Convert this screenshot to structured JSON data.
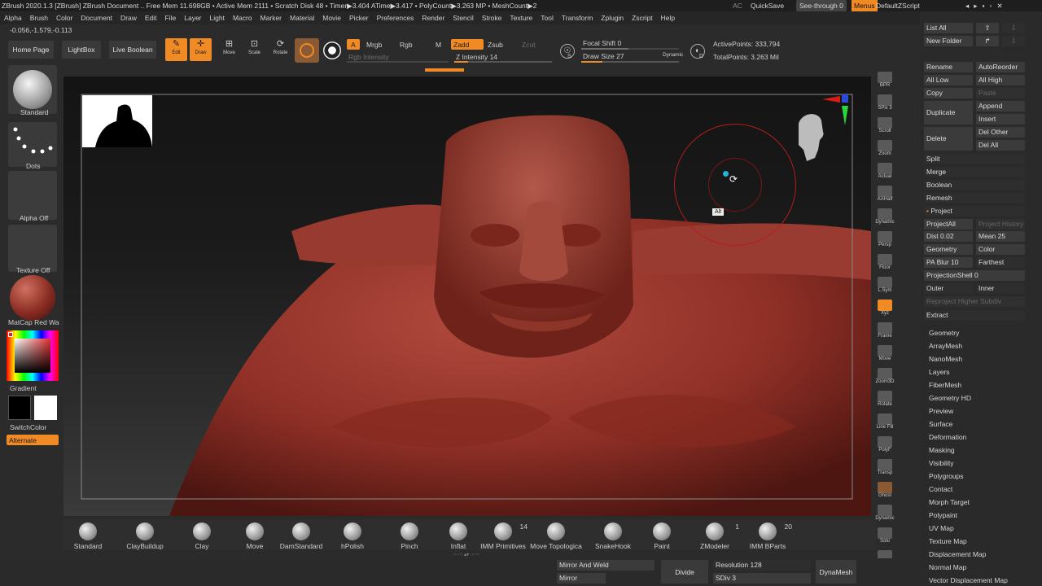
{
  "titlebar": {
    "text": "ZBrush 2020.1.3 [ZBrush]   ZBrush Document     .. Free Mem 11.698GB • Active Mem 2111 • Scratch Disk 48 •  Timer▶3.404 ATime▶3.417 • PolyCount▶3.263 MP  • MeshCount▶2",
    "ac": "AC",
    "quicksave": "QuickSave",
    "seethrough": "See-through  0",
    "menus": "Menus",
    "defaultzscript": "DefaultZScript"
  },
  "menubar": [
    "Alpha",
    "Brush",
    "Color",
    "Document",
    "Draw",
    "Edit",
    "File",
    "Layer",
    "Light",
    "Macro",
    "Marker",
    "Material",
    "Movie",
    "Picker",
    "Preferences",
    "Render",
    "Stencil",
    "Stroke",
    "Texture",
    "Tool",
    "Transform",
    "Zplugin",
    "Zscript",
    "Help"
  ],
  "coords": "-0.056,-1.579,-0.113",
  "toolbar": {
    "home": "Home Page",
    "lightbox": "LightBox",
    "liveboolean": "Live Boolean",
    "edit": "Edit",
    "draw": "Draw",
    "move": "Move",
    "scale": "Scale",
    "rotate": "Rotate",
    "a": "A",
    "mrgb": "Mrgb",
    "rgb": "Rgb",
    "m": "M",
    "zadd": "Zadd",
    "zsub": "Zsub",
    "zcut": "Zcut",
    "rgb_intensity": "Rgb Intensity",
    "z_intensity": "Z Intensity 14",
    "z_intensity_level": 0.14,
    "focal": "Focal Shift 0",
    "drawsize": "Draw Size 27",
    "dynamic": "Dynamic",
    "activepoints": "ActivePoints: 333,794",
    "totalpoints": "TotalPoints: 3.263 Mil",
    "s": "S",
    "d": "D"
  },
  "leftpanel": {
    "standard": "Standard",
    "dots": "Dots",
    "alphaoff": "Alpha Off",
    "textureoff": "Texture Off",
    "matcap": "MatCap Red Wa",
    "gradient": "Gradient",
    "switchcolor": "SwitchColor",
    "alternate": "Alternate"
  },
  "viewport": {
    "alt_label": "Alt"
  },
  "righttools": [
    "BPR",
    "SPix 3",
    "Scroll",
    "Zoom",
    "Actual",
    "AAHalf",
    "Dynamic",
    "Persp",
    "Floor",
    "L.Sym",
    "Xyz",
    "Frame",
    "Move",
    "Zoom3D",
    "Rotate",
    "Line Fill",
    "PolyF",
    "Transp",
    "Ghost",
    "Dynamic",
    "Solo",
    "Xpose"
  ],
  "rpanel": {
    "listall": "List All",
    "newfolder": "New Folder",
    "rename": "Rename",
    "autoreorder": "AutoReorder",
    "alllow": "All Low",
    "allhigh": "All High",
    "copy": "Copy",
    "paste": "Paste",
    "duplicate": "Duplicate",
    "append": "Append",
    "insert": "Insert",
    "delete": "Delete",
    "delother": "Del Other",
    "delall": "Del All",
    "split": "Split",
    "merge": "Merge",
    "boolean": "Boolean",
    "remesh": "Remesh",
    "project": "Project",
    "projectall": "ProjectAll",
    "projecthistory": "Project History",
    "dist": "Dist 0.02",
    "mean": "Mean 25",
    "geometry_btn": "Geometry",
    "color_btn": "Color",
    "pablur": "PA Blur 10",
    "farthest": "Farthest",
    "projectionshell": "ProjectionShell 0",
    "outer": "Outer",
    "inner": "Inner",
    "reproject": "Reproject Higher Subdiv",
    "extract": "Extract",
    "subpalettes": [
      "Geometry",
      "ArrayMesh",
      "NanoMesh",
      "Layers",
      "FiberMesh",
      "Geometry HD",
      "Preview",
      "Surface",
      "Deformation",
      "Masking",
      "Visibility",
      "Polygroups",
      "Contact",
      "Morph Target",
      "Polypaint",
      "UV Map",
      "Texture Map",
      "Displacement Map",
      "Normal Map",
      "Vector Displacement Map"
    ]
  },
  "shelf": [
    {
      "label": "Standard"
    },
    {
      "label": "ClayBuildup"
    },
    {
      "label": "Clay"
    },
    {
      "label": "Move"
    },
    {
      "label": "DamStandard"
    },
    {
      "label": "hPolish"
    },
    {
      "label": "Pinch"
    },
    {
      "label": "Inflat"
    },
    {
      "label": "IMM Primitives",
      "count": "14"
    },
    {
      "label": "Move Topologica"
    },
    {
      "label": "SnakeHook"
    },
    {
      "label": "Paint"
    },
    {
      "label": "ZModeler",
      "count": "1"
    },
    {
      "label": "IMM BParts",
      "count": "20"
    }
  ],
  "bottom": {
    "mirrorweld": "Mirror And Weld",
    "mirror": "Mirror",
    "divide": "Divide",
    "resolution": "Resolution 128",
    "sdiv": "SDiv 3",
    "dynamesh": "DynaMesh"
  }
}
